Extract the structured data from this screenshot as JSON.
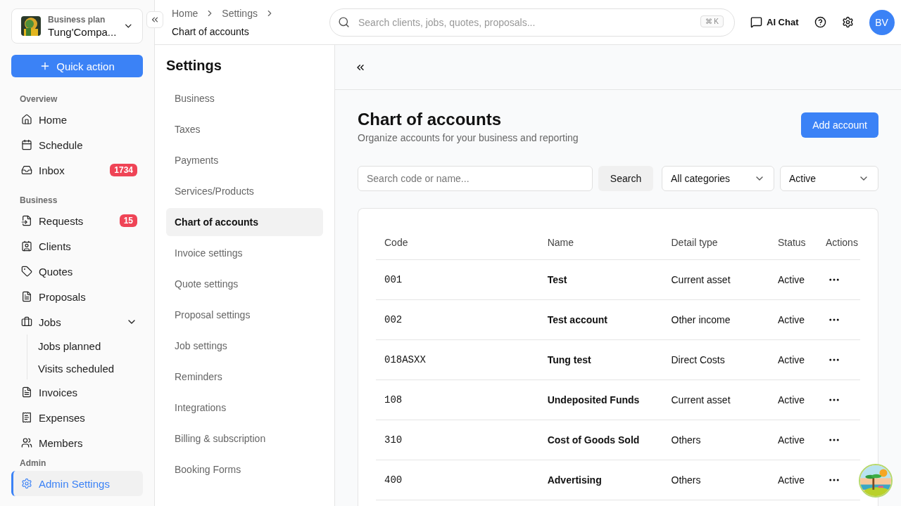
{
  "company": {
    "plan": "Business plan",
    "name": "Tung'Compa..."
  },
  "quick_action": "Quick action",
  "sidebar": [
    {
      "heading": "Overview",
      "items": [
        {
          "label": "Home",
          "selected": false
        },
        {
          "label": "Schedule",
          "selected": false
        },
        {
          "label": "Inbox",
          "badge": "1734",
          "selected": false
        }
      ]
    },
    {
      "heading": "Business",
      "items": [
        {
          "label": "Requests",
          "badge": "15",
          "selected": false
        },
        {
          "label": "Clients",
          "selected": false
        },
        {
          "label": "Quotes",
          "selected": false
        },
        {
          "label": "Proposals",
          "selected": false
        },
        {
          "label": "Jobs",
          "expanded": true,
          "selected": false,
          "children": [
            {
              "label": "Jobs planned",
              "selected": false
            },
            {
              "label": "Visits scheduled",
              "selected": false
            }
          ]
        },
        {
          "label": "Invoices",
          "selected": false
        },
        {
          "label": "Expenses",
          "selected": false
        },
        {
          "label": "Members",
          "selected": false
        }
      ]
    },
    {
      "heading": "Admin",
      "items": [
        {
          "label": "Admin Settings",
          "selected": true
        }
      ]
    }
  ],
  "breadcrumb": [
    "Home",
    "Settings",
    "Chart of accounts"
  ],
  "search": {
    "placeholder": "Search clients, jobs, quotes, proposals...",
    "shortcut": "⌘ K"
  },
  "top_actions": {
    "ai_chat": "AI Chat",
    "avatar": "BV"
  },
  "settings_nav": {
    "title": "Settings",
    "items": [
      {
        "label": "Business",
        "selected": false
      },
      {
        "label": "Taxes",
        "selected": false
      },
      {
        "label": "Payments",
        "selected": false
      },
      {
        "label": "Services/Products",
        "selected": false
      },
      {
        "label": "Chart of accounts",
        "selected": true
      },
      {
        "label": "Invoice settings",
        "selected": false
      },
      {
        "label": "Quote settings",
        "selected": false
      },
      {
        "label": "Proposal settings",
        "selected": false
      },
      {
        "label": "Job settings",
        "selected": false
      },
      {
        "label": "Reminders",
        "selected": false
      },
      {
        "label": "Integrations",
        "selected": false
      },
      {
        "label": "Billing & subscription",
        "selected": false
      },
      {
        "label": "Booking Forms",
        "selected": false
      }
    ]
  },
  "page": {
    "title": "Chart of accounts",
    "subtitle": "Organize accounts for your business and reporting",
    "add_button": "Add account"
  },
  "filters": {
    "search_placeholder": "Search code or name...",
    "search_button": "Search",
    "category": "All categories",
    "status": "Active"
  },
  "table": {
    "columns": [
      "Code",
      "Name",
      "Detail type",
      "Status",
      "Actions"
    ],
    "rows": [
      {
        "code": "001",
        "name": "Test",
        "detail_type": "Current asset",
        "status": "Active"
      },
      {
        "code": "002",
        "name": "Test account",
        "detail_type": "Other income",
        "status": "Active"
      },
      {
        "code": "018ASXX",
        "name": "Tung test",
        "detail_type": "Direct Costs",
        "status": "Active"
      },
      {
        "code": "108",
        "name": "Undeposited Funds",
        "detail_type": "Current asset",
        "status": "Active"
      },
      {
        "code": "310",
        "name": "Cost of Goods Sold",
        "detail_type": "Others",
        "status": "Active"
      },
      {
        "code": "400",
        "name": "Advertising",
        "detail_type": "Others",
        "status": "Active"
      }
    ]
  }
}
